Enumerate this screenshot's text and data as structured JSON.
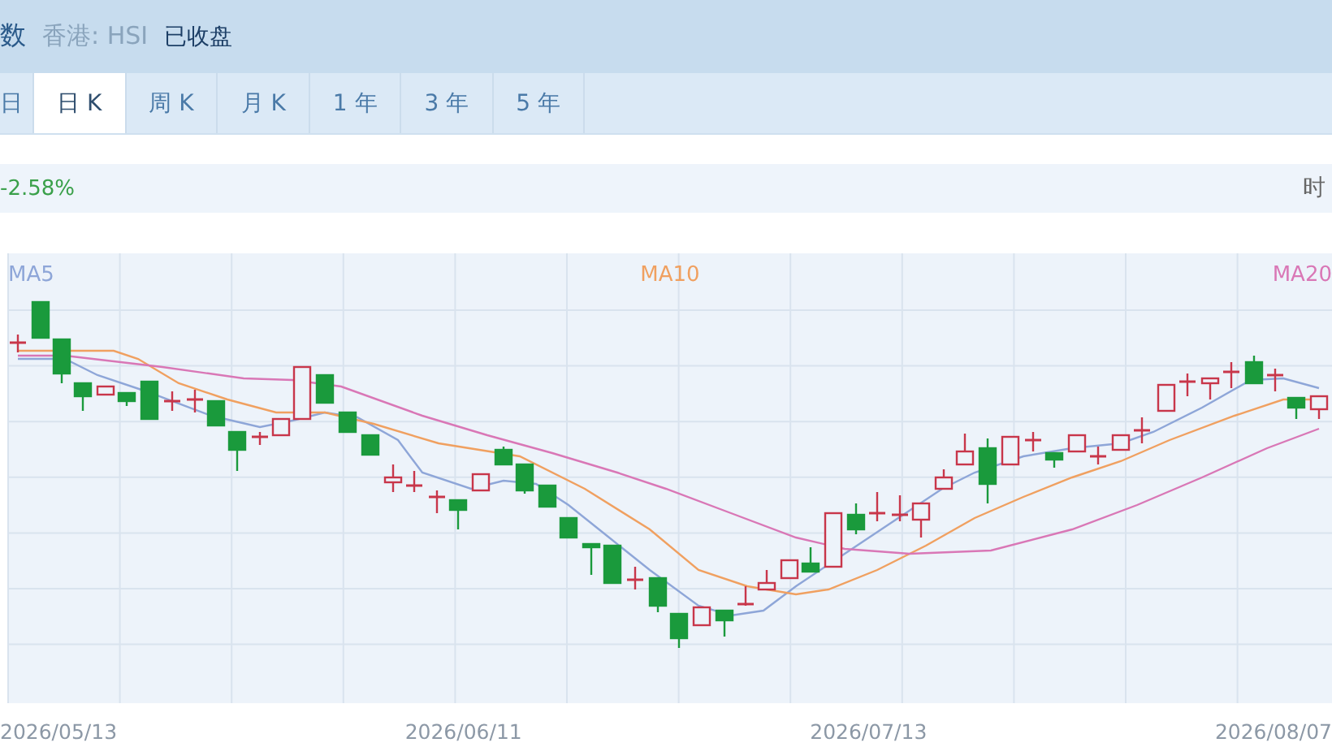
{
  "header": {
    "title_fragment": "数",
    "symbol": "香港: HSI",
    "status": "已收盘"
  },
  "tabs": [
    {
      "label": "日",
      "selected": false
    },
    {
      "label": "日 K",
      "selected": true
    },
    {
      "label": "周 K",
      "selected": false
    },
    {
      "label": "月 K",
      "selected": false
    },
    {
      "label": "1 年",
      "selected": false
    },
    {
      "label": "3 年",
      "selected": false
    },
    {
      "label": "5 年",
      "selected": false
    }
  ],
  "info_bar": {
    "change": "-2.58%",
    "time_label": "时"
  },
  "chart": {
    "legend": [
      {
        "label": "MA5",
        "color": "#8ea6d8"
      },
      {
        "label": "MA10",
        "color": "#f0a060"
      },
      {
        "label": "MA20",
        "color": "#d977b6"
      }
    ],
    "x_labels": [
      "2026/05/13",
      "2026/06/11",
      "2026/07/13",
      "2026/08/07"
    ]
  }
}
